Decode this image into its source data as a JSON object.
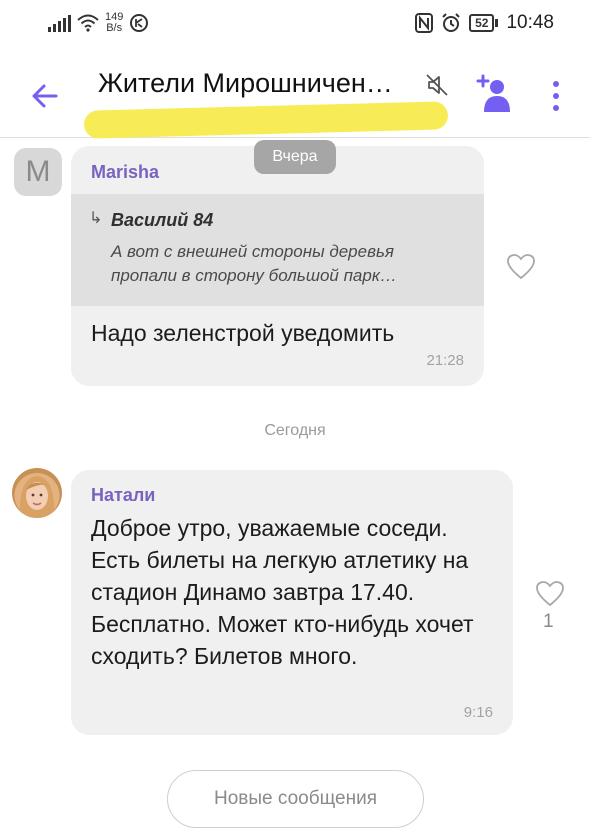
{
  "status_bar": {
    "speed_value": "149",
    "speed_unit": "B/s",
    "battery": "52",
    "time": "10:48",
    "icons": [
      "signal-icon",
      "wifi-icon",
      "vpn-icon",
      "nfc-icon",
      "alarm-icon",
      "battery-icon"
    ]
  },
  "header": {
    "title": "Жители Мирошничен…",
    "icons": [
      "back-arrow-icon",
      "muted-bell-icon",
      "add-participant-icon",
      "more-vert-icon"
    ]
  },
  "date_labels": {
    "yesterday": "Вчера",
    "today": "Сегодня"
  },
  "messages": [
    {
      "sender": "Marisha",
      "avatar_letter": "M",
      "reply": {
        "author": "Василий 84",
        "text": "А вот с внешней стороны деревья пропали в сторону большой парк…"
      },
      "text": "Надо зеленстрой уведомить",
      "time": "21:28",
      "likes": ""
    },
    {
      "sender": "Натали",
      "text": "Доброе утро, уважаемые соседи. Есть билеты на легкую атлетику на  стадион Динамо завтра 17.40. Бесплатно. Может кто-нибудь хочет сходить? Билетов много.",
      "time": "9:16",
      "likes": "1"
    }
  ],
  "new_messages_button": "Новые сообщения",
  "colors": {
    "accent": "#7360f2",
    "sender": "#7a63c0",
    "bubble": "#f0f0f0",
    "quote": "#e0e0e0",
    "highlight": "#f7ec55"
  }
}
